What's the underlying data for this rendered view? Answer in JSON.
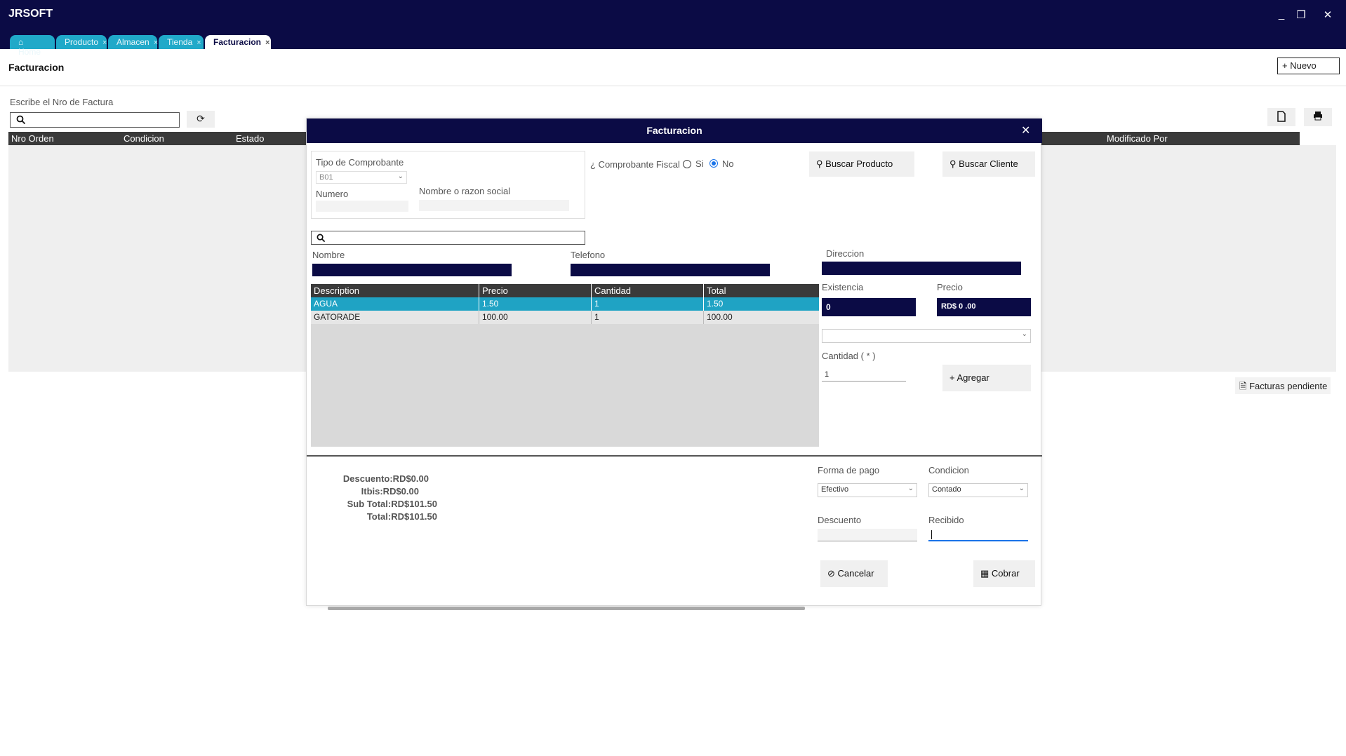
{
  "app": {
    "title": "JRSOFT",
    "minimize": "_",
    "restore": "❐",
    "close": "✕"
  },
  "tabs": [
    {
      "label": "Home",
      "icon": "home-icon"
    },
    {
      "label": "Producto",
      "close": "×"
    },
    {
      "label": "Almacen",
      "close": "×"
    },
    {
      "label": "Tienda",
      "close": "×"
    },
    {
      "label": "Facturacion",
      "close": "×"
    }
  ],
  "page": {
    "title": "Facturacion",
    "new_button": "+ Nuevo",
    "search_label": "Escribe el Nro de Factura",
    "pending_button": "Facturas pendiente",
    "grid_columns": [
      "Nro Orden",
      "Condicion",
      "Estado",
      "Modificado Por"
    ]
  },
  "modal": {
    "title": "Facturacion",
    "close": "✕",
    "tipo_comprobante_label": "Tipo de Comprobante",
    "tipo_comprobante_value": "B01",
    "numero_label": "Numero",
    "nombre_razon_label": "Nombre o razon social",
    "comprobante_fiscal_label": "¿ Comprobante Fiscal",
    "radio_si": "Si",
    "radio_no": "No",
    "buscar_producto": "Buscar Producto",
    "buscar_cliente": "Buscar Cliente",
    "nombre_label": "Nombre",
    "telefono_label": "Telefono",
    "direccion_label": "Direccion",
    "existencia_label": "Existencia",
    "existencia_value": "0",
    "precio_label": "Precio",
    "precio_value": "RD$ 0 .00",
    "cantidad_label": "Cantidad ( * )",
    "cantidad_value": "1",
    "agregar": "Agregar",
    "table": {
      "columns": [
        "Description",
        "Precio",
        "Cantidad",
        "Total"
      ],
      "rows": [
        [
          "AGUA",
          "1.50",
          "1",
          "1.50"
        ],
        [
          "GATORADE",
          "100.00",
          "1",
          "100.00"
        ]
      ]
    },
    "summary": {
      "descuento": "Descuento:RD$0.00",
      "itbis": "Itbis:RD$0.00",
      "subtotal": "Sub Total:RD$101.50",
      "total": "Total:RD$101.50"
    },
    "forma_pago_label": "Forma de pago",
    "forma_pago_value": "Efectivo",
    "condicion_label": "Condicion",
    "condicion_value": "Contado",
    "descuento_label": "Descuento",
    "recibido_label": "Recibido",
    "cancelar": "Cancelar",
    "cobrar": "Cobrar"
  },
  "colors": {
    "navy": "#0b0b45",
    "tab": "#20a9c9",
    "selected_row": "#1fa3c4"
  }
}
